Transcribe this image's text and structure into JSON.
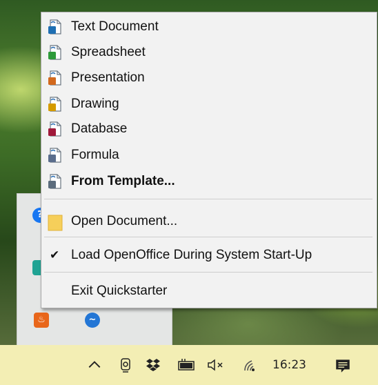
{
  "menu": {
    "new_items": [
      {
        "label": "Text Document",
        "icon": "text-document-icon",
        "color": "#1f6fb3"
      },
      {
        "label": "Spreadsheet",
        "icon": "spreadsheet-icon",
        "color": "#2e9b3a"
      },
      {
        "label": "Presentation",
        "icon": "presentation-icon",
        "color": "#d2691e"
      },
      {
        "label": "Drawing",
        "icon": "drawing-icon",
        "color": "#d59b00"
      },
      {
        "label": "Database",
        "icon": "database-icon",
        "color": "#a0193a"
      },
      {
        "label": "Formula",
        "icon": "formula-icon",
        "color": "#5a6d8c"
      },
      {
        "label": "From Template...",
        "icon": "template-icon",
        "color": "#5b6c7d"
      }
    ],
    "open_document": "Open Document...",
    "load_startup": "Load OpenOffice During System Start-Up",
    "load_startup_checked": true,
    "exit": "Exit Quickstarter"
  },
  "taskbar": {
    "time": "16:23",
    "icons": [
      "chevron-up-icon",
      "webcam-icon",
      "dropbox-icon",
      "battery-icon",
      "volume-muted-icon",
      "wifi-icon",
      "notification-icon"
    ]
  }
}
